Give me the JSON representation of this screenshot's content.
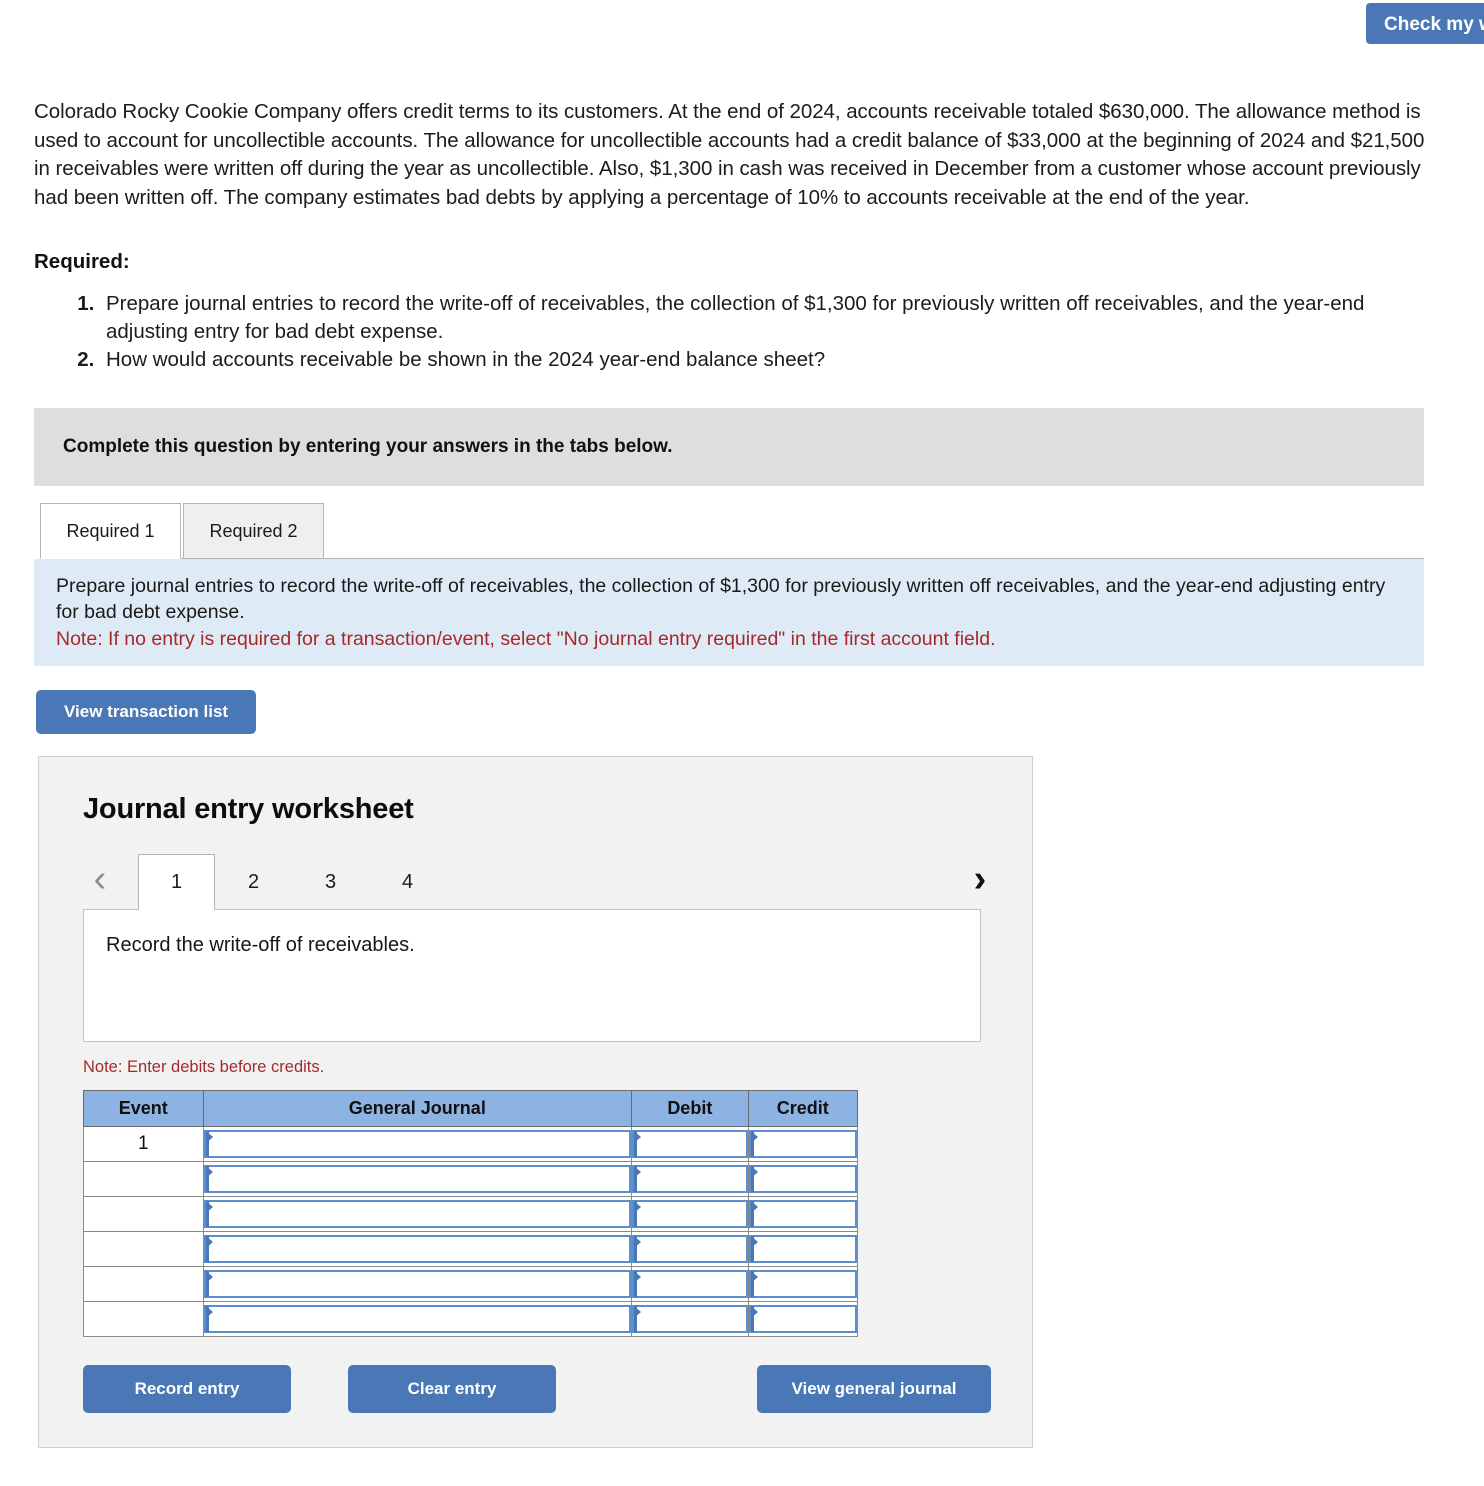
{
  "header": {
    "check_my_work_label": "Check my work"
  },
  "problem": {
    "body": "Colorado Rocky Cookie Company offers credit terms to its customers. At the end of 2024, accounts receivable totaled $630,000. The allowance method is used to account for uncollectible accounts. The allowance for uncollectible accounts had a credit balance of $33,000 at the beginning of 2024 and $21,500 in receivables were written off during the year as uncollectible. Also, $1,300 in cash was received in December from a customer whose account previously had been written off. The company estimates bad debts by applying a percentage of 10% to accounts receivable at the end of the year.",
    "required_heading": "Required:",
    "requirements": [
      "Prepare journal entries to record the write-off of receivables, the collection of $1,300 for previously written off receivables, and the year-end adjusting entry for bad debt expense.",
      "How would accounts receivable be shown in the 2024 year-end balance sheet?"
    ]
  },
  "banner": {
    "text": "Complete this question by entering your answers in the tabs below."
  },
  "tabs": [
    {
      "label": "Required 1",
      "active": true
    },
    {
      "label": "Required 2",
      "active": false
    }
  ],
  "instructions": {
    "main": "Prepare journal entries to record the write-off of receivables, the collection of $1,300 for previously written off receivables, and the year-end adjusting entry for bad debt expense.",
    "note": "Note: If no entry is required for a transaction/event, select \"No journal entry required\" in the first account field."
  },
  "buttons": {
    "view_transaction_list": "View transaction list",
    "record_entry": "Record entry",
    "clear_entry": "Clear entry",
    "view_general_journal": "View general journal"
  },
  "worksheet": {
    "title": "Journal entry worksheet",
    "pager": {
      "prev_icon": "chevron-left",
      "next_icon": "chevron-right",
      "prev_glyph": "‹",
      "next_glyph": "›",
      "pages": [
        "1",
        "2",
        "3",
        "4"
      ],
      "active_page": "1"
    },
    "transaction_description": "Record the write-off of receivables.",
    "note_debits": "Note: Enter debits before credits.",
    "table": {
      "columns": [
        "Event",
        "General Journal",
        "Debit",
        "Credit"
      ],
      "rows": [
        {
          "event": "1",
          "general_journal": "",
          "debit": "",
          "credit": ""
        },
        {
          "event": "",
          "general_journal": "",
          "debit": "",
          "credit": ""
        },
        {
          "event": "",
          "general_journal": "",
          "debit": "",
          "credit": ""
        },
        {
          "event": "",
          "general_journal": "",
          "debit": "",
          "credit": ""
        },
        {
          "event": "",
          "general_journal": "",
          "debit": "",
          "credit": ""
        },
        {
          "event": "",
          "general_journal": "",
          "debit": "",
          "credit": ""
        }
      ]
    }
  },
  "colors": {
    "button_blue": "#4a77b5",
    "table_header_blue": "#8db3e2",
    "instruction_panel_blue": "#deeaf6",
    "banner_gray": "#dedede",
    "panel_gray": "#f2f2f2",
    "note_red": "#a52a2a"
  }
}
